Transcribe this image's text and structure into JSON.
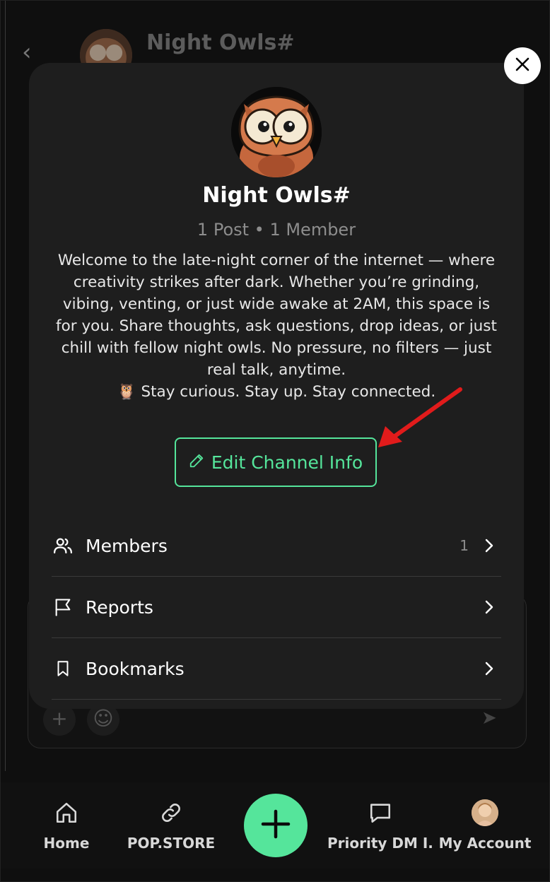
{
  "background": {
    "channel_title": "Night Owls#"
  },
  "modal": {
    "close_icon": "close-icon",
    "channel_name": "Night Owls#",
    "stats": "1 Post • 1 Member",
    "description_lines": [
      "Welcome to the late-night corner of the internet — where",
      "creativity strikes after dark. Whether you’re grinding,",
      "vibing, venting, or just wide awake at 2AM, this space is",
      "for you. Share thoughts, ask questions, drop ideas, or just",
      "chill with fellow night owls. No pressure, no filters — just",
      "real talk, anytime.",
      "🦉 Stay curious. Stay up. Stay connected."
    ],
    "edit_button_label": "Edit Channel Info",
    "menu": [
      {
        "label": "Members",
        "count": "1",
        "icon": "users-icon"
      },
      {
        "label": "Reports",
        "count": "",
        "icon": "flag-icon"
      },
      {
        "label": "Bookmarks",
        "count": "",
        "icon": "bookmark-icon"
      }
    ]
  },
  "bottom_nav": {
    "items": [
      {
        "label": "Home",
        "icon": "home-icon"
      },
      {
        "label": "POP.STORE",
        "icon": "link-icon"
      },
      {
        "label": "Priority DM I...",
        "icon": "chat-icon"
      },
      {
        "label": "My Account",
        "icon": "avatar"
      }
    ],
    "fab_icon": "plus-icon"
  },
  "colors": {
    "accent": "#55e59b",
    "modal_bg": "#1e1e1e",
    "annotation_arrow": "#e11b1b"
  }
}
